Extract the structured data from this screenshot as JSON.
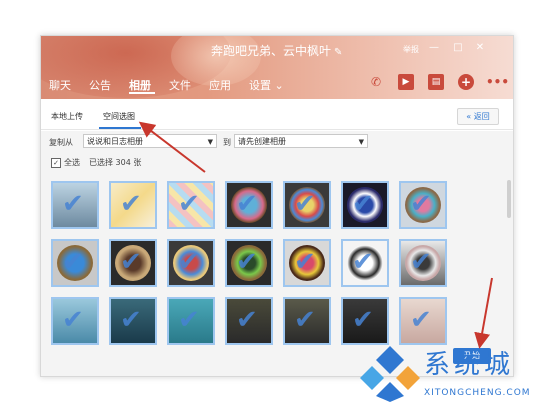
{
  "window": {
    "title": "奔跑吧兄弟、云中枫叶",
    "edit_icon": "edit-icon",
    "report": "举报",
    "min": "—",
    "max": "□",
    "close": "✕"
  },
  "tabs": [
    "聊天",
    "公告",
    "相册",
    "文件",
    "应用",
    "设置 ⌄"
  ],
  "active_tab": "相册",
  "header_icons": [
    "phone-icon",
    "video-icon",
    "document-icon",
    "add-icon",
    "more-icon"
  ],
  "subtabs": {
    "upload": "本地上传",
    "space": "空间选图",
    "back": "返回"
  },
  "toolbar": {
    "copy_from": "复制从",
    "source_album": "说说和日志相册",
    "to": "到",
    "target_album": "请先创建相册"
  },
  "selection": {
    "select_all": "全选",
    "selected_count": "已选择 304 张"
  },
  "start_button": "开始",
  "watermark": {
    "name": "系统城",
    "url": "XITONGCHENG.COM"
  },
  "colors": {
    "accent": "#2f77d1",
    "header": "#e39a80",
    "icon": "#c94a3c"
  }
}
